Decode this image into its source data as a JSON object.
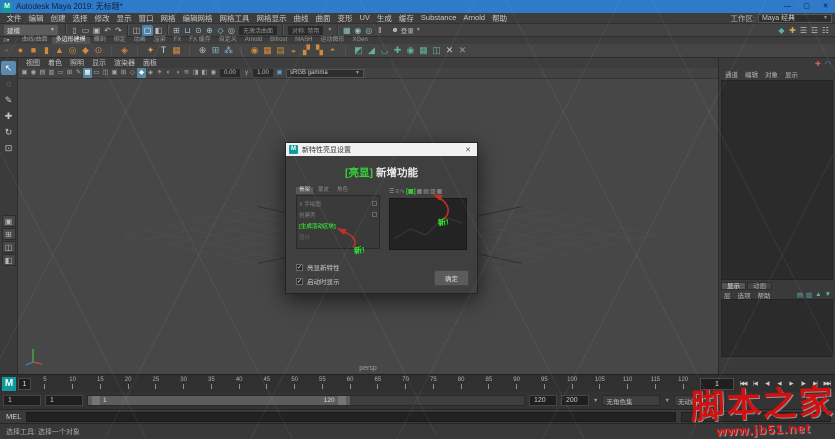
{
  "icons": {
    "chevron_down": "▼",
    "close": "✕",
    "check": "✓",
    "maya_logo": "M"
  },
  "window": {
    "title": "Autodesk Maya 2019: 无标题*",
    "controls": [
      {
        "name": "minimize-button",
        "glyph": "—"
      },
      {
        "name": "maximize-button",
        "glyph": "▢"
      },
      {
        "name": "close-button",
        "glyph": "✕"
      }
    ]
  },
  "menubar": {
    "items": [
      "文件",
      "编辑",
      "创建",
      "选择",
      "修改",
      "显示",
      "窗口",
      "网格",
      "编辑网格",
      "网格工具",
      "网格显示",
      "曲线",
      "曲面",
      "变形",
      "UV",
      "生成",
      "缓存",
      "Substance",
      "Arnold",
      "帮助"
    ],
    "workspace_label": "工作区:",
    "workspace_value": "Maya 经典"
  },
  "statusline": {
    "mode_value": "建模",
    "file_icons": [
      {
        "name": "new-scene-icon",
        "glyph": "▯"
      },
      {
        "name": "open-scene-icon",
        "glyph": "▭"
      },
      {
        "name": "save-scene-icon",
        "glyph": "▣"
      },
      {
        "name": "undo-icon",
        "glyph": "↶"
      },
      {
        "name": "redo-icon",
        "glyph": "↷"
      }
    ],
    "selection_icons": [
      {
        "name": "select-hierarchy-icon",
        "glyph": "◫"
      },
      {
        "name": "select-object-icon",
        "glyph": "▢",
        "active": true
      },
      {
        "name": "select-component-icon",
        "glyph": "◧"
      }
    ],
    "snap_icons": [
      {
        "name": "snap-to-grid-icon",
        "glyph": "⊞",
        "color": "#9cc4d6"
      },
      {
        "name": "snap-to-curve-icon",
        "glyph": "⊔",
        "color": "#9cc4d6"
      },
      {
        "name": "snap-to-point-icon",
        "glyph": "⊙",
        "color": "#9cc4d6"
      },
      {
        "name": "snap-to-projected-center-icon",
        "glyph": "⊕",
        "color": "#9cc4d6"
      },
      {
        "name": "snap-to-view-plane-icon",
        "glyph": "◇",
        "color": "#9cc4d6"
      },
      {
        "name": "make-live-icon",
        "glyph": "◎",
        "color": "#9cc4d6"
      }
    ],
    "surface_field": "无激活曲面",
    "symmetry_field": "对称: 禁用",
    "render_icons": [
      {
        "name": "render-view-icon",
        "glyph": "▦",
        "color": "#8fc3c3"
      },
      {
        "name": "render-current-frame-icon",
        "glyph": "◉",
        "color": "#8fc3c3"
      },
      {
        "name": "ipr-render-icon",
        "glyph": "◎",
        "color": "#8fc3c3"
      },
      {
        "name": "pause-icon",
        "glyph": "‖",
        "color": "#c0c0c0"
      }
    ],
    "signin_label": "登录",
    "person_glyph": "☻",
    "right_icons": [
      {
        "name": "modeling-toolkit-icon",
        "glyph": "◆",
        "color": "#58b0a8"
      },
      {
        "name": "humanik-icon",
        "glyph": "✚",
        "color": "#c7b35a"
      },
      {
        "name": "attribute-editor-icon",
        "glyph": "☰"
      },
      {
        "name": "tool-settings-icon",
        "glyph": "☲"
      },
      {
        "name": "channel-box-icon",
        "glyph": "☷"
      }
    ]
  },
  "shelf": {
    "edge_icons": [
      {
        "name": "shelf-menu-icon",
        "glyph": "≡"
      },
      {
        "name": "shelf-switch-icon",
        "glyph": "▾"
      }
    ],
    "tabs": [
      {
        "label": "曲线/曲面"
      },
      {
        "label": "多边形建模",
        "active": true
      },
      {
        "label": "雕刻"
      },
      {
        "label": "绑定"
      },
      {
        "label": "动画"
      },
      {
        "label": "渲染"
      },
      {
        "label": "FX"
      },
      {
        "label": "FX 缓存"
      },
      {
        "label": "自定义"
      },
      {
        "label": "Arnold"
      },
      {
        "label": "Bifrost"
      },
      {
        "label": "MASH"
      },
      {
        "label": "运动图形"
      },
      {
        "label": "XGen"
      }
    ],
    "icons": [
      {
        "name": "poly-sphere-icon",
        "glyph": "●",
        "color": "#cf8a3c"
      },
      {
        "name": "poly-cube-icon",
        "glyph": "■",
        "color": "#cf8a3c"
      },
      {
        "name": "poly-cylinder-icon",
        "glyph": "▮",
        "color": "#cf8a3c"
      },
      {
        "name": "poly-cone-icon",
        "glyph": "▲",
        "color": "#cf8a3c"
      },
      {
        "name": "poly-torus-icon",
        "glyph": "◎",
        "color": "#cf8a3c"
      },
      {
        "name": "poly-plane-icon",
        "glyph": "◆",
        "color": "#cf8a3c"
      },
      {
        "name": "poly-disc-icon",
        "glyph": "⊙",
        "color": "#cf8a3c"
      },
      {
        "name": "shelf-separator",
        "glyph": "❘",
        "color": "#5a5a5a"
      },
      {
        "name": "platonic-solid-icon",
        "glyph": "◈",
        "color": "#cf8a3c"
      },
      {
        "name": "shelf-separator",
        "glyph": "❘",
        "color": "#5a5a5a"
      },
      {
        "name": "super-shape-icon",
        "glyph": "✦",
        "color": "#d8a050"
      },
      {
        "name": "type-tool-icon",
        "glyph": "T",
        "color": "#d0d0d0"
      },
      {
        "name": "svg-tool-icon",
        "glyph": "▦",
        "color": "#cf8a3c"
      },
      {
        "name": "shelf-separator",
        "glyph": "❘",
        "color": "#5a5a5a"
      },
      {
        "name": "construction-aim-icon",
        "glyph": "⊕",
        "color": "#b8b8b8"
      },
      {
        "name": "measure-tool-icon",
        "glyph": "⊞",
        "color": "#7fb6c6"
      },
      {
        "name": "joint-tool-icon",
        "glyph": "⁂",
        "color": "#7fb6c6"
      },
      {
        "name": "shelf-separator",
        "glyph": "❘",
        "color": "#5a5a5a"
      },
      {
        "name": "sculpt-tool-icon",
        "glyph": "◉",
        "color": "#cf8a3c"
      },
      {
        "name": "mash-network-icon",
        "glyph": "▦",
        "color": "#cf8a3c"
      },
      {
        "name": "lattice-icon",
        "glyph": "▤",
        "color": "#cf8a3c"
      },
      {
        "name": "cluster-icon",
        "glyph": "◒",
        "color": "#cf8a3c"
      },
      {
        "name": "combine-icon",
        "glyph": "▞",
        "color": "#cf8a3c"
      },
      {
        "name": "separate-icon",
        "glyph": "▚",
        "color": "#cf8a3c"
      },
      {
        "name": "smooth-icon",
        "glyph": "◓",
        "color": "#cf8a3c"
      },
      {
        "name": "shelf-separator",
        "glyph": "❘",
        "color": "#5a5a5a"
      },
      {
        "name": "extrude-icon",
        "glyph": "◩",
        "color": "#63b0a2"
      },
      {
        "name": "bevel-icon",
        "glyph": "◢",
        "color": "#63b0a2"
      },
      {
        "name": "bridge-icon",
        "glyph": "◡",
        "color": "#63b0a2"
      },
      {
        "name": "multi-cut-icon",
        "glyph": "✚",
        "color": "#63b0a2"
      },
      {
        "name": "target-weld-icon",
        "glyph": "◉",
        "color": "#63b0a2"
      },
      {
        "name": "quad-draw-icon",
        "glyph": "▦",
        "color": "#63b0a2"
      },
      {
        "name": "symmetrize-icon",
        "glyph": "◫",
        "color": "#63b0a2"
      },
      {
        "name": "delete-edge-icon",
        "glyph": "✕",
        "color": "#c8c8c8"
      },
      {
        "name": "collapse-edge-icon",
        "glyph": "✕",
        "color": "#9a9a9a"
      }
    ]
  },
  "toolbox": {
    "tools": [
      {
        "name": "select-tool",
        "glyph": "↖",
        "active": true
      },
      {
        "name": "lasso-select-tool",
        "glyph": "◌"
      },
      {
        "name": "paint-select-tool",
        "glyph": "✎"
      },
      {
        "name": "move-tool",
        "glyph": "✚"
      },
      {
        "name": "rotate-tool",
        "glyph": "↻"
      },
      {
        "name": "scale-tool",
        "glyph": "⊡"
      }
    ],
    "layouts": [
      {
        "name": "layout-single-pane",
        "glyph": "▣"
      },
      {
        "name": "layout-four-pane",
        "glyph": "⊞"
      },
      {
        "name": "layout-persp-outliner",
        "glyph": "◫"
      },
      {
        "name": "layout-hypershade",
        "glyph": "◧"
      }
    ]
  },
  "viewport": {
    "menus": [
      "视图",
      "着色",
      "照明",
      "显示",
      "渲染器",
      "面板"
    ],
    "iconbar": [
      {
        "name": "select-camera-icon",
        "glyph": "▣"
      },
      {
        "name": "lock-camera-icon",
        "glyph": "◉"
      },
      {
        "name": "camera-attributes-icon",
        "glyph": "▤"
      },
      {
        "name": "bookmarks-icon",
        "glyph": "▥"
      },
      {
        "name": "image-plane-icon",
        "glyph": "▭"
      },
      {
        "name": "2d-pan-zoom-icon",
        "glyph": "⊞"
      },
      {
        "name": "grease-pencil-icon",
        "glyph": "✎"
      },
      {
        "name": "grid-toggle-icon",
        "glyph": "▦",
        "active": true
      },
      {
        "name": "film-gate-icon",
        "glyph": "▭"
      },
      {
        "name": "resolution-gate-icon",
        "glyph": "◫"
      },
      {
        "name": "gate-mask-icon",
        "glyph": "▣"
      },
      {
        "name": "field-chart-icon",
        "glyph": "⊞"
      },
      {
        "name": "wireframe-icon",
        "glyph": "◇"
      },
      {
        "name": "shaded-icon",
        "glyph": "◆",
        "active": true
      },
      {
        "name": "textured-icon",
        "glyph": "◈"
      },
      {
        "name": "use-all-lights-icon",
        "glyph": "☀"
      },
      {
        "name": "shadows-icon",
        "glyph": "◐"
      },
      {
        "name": "ao-icon",
        "glyph": "◑"
      },
      {
        "name": "motion-blur-icon",
        "glyph": "≋"
      },
      {
        "name": "isolate-select-icon",
        "glyph": "◨"
      },
      {
        "name": "xray-icon",
        "glyph": "◧"
      },
      {
        "name": "exposure-icon",
        "glyph": "◉"
      }
    ],
    "exposure_value": "0.00",
    "gamma_icon": "γ",
    "gamma_value": "1.00",
    "view_transform": "sRGB gamma",
    "camera_label": "persp"
  },
  "channel_box": {
    "top_icons": [
      {
        "name": "character-set-icon",
        "glyph": "✚",
        "color": "#cc6655"
      },
      {
        "name": "anim-layer-icon",
        "glyph": "◠",
        "color": "#55aacc"
      }
    ],
    "menus": [
      "通道",
      "编辑",
      "对象",
      "显示"
    ]
  },
  "layer_editor": {
    "tabs": [
      {
        "label": "显示",
        "active": true
      },
      {
        "label": "动画"
      }
    ],
    "menus": [
      "层",
      "选项",
      "帮助"
    ],
    "icons": [
      {
        "name": "new-empty-layer-icon",
        "glyph": "▤"
      },
      {
        "name": "new-layer-from-selected-icon",
        "glyph": "▥"
      },
      {
        "name": "move-layer-up-icon",
        "glyph": "▲"
      },
      {
        "name": "move-layer-down-icon",
        "glyph": "▼"
      }
    ]
  },
  "timeline": {
    "current_frame": "1",
    "ticks": [
      "5",
      "10",
      "15",
      "20",
      "25",
      "30",
      "35",
      "40",
      "45",
      "50",
      "55",
      "60",
      "65",
      "70",
      "75",
      "80",
      "85",
      "90",
      "95",
      "100",
      "105",
      "110",
      "115",
      "120"
    ],
    "frame_field": "1",
    "playback": [
      {
        "name": "go-to-start-button",
        "glyph": "|◀◀"
      },
      {
        "name": "step-back-frame-button",
        "glyph": "|◀"
      },
      {
        "name": "step-back-key-button",
        "glyph": "◀|"
      },
      {
        "name": "play-backwards-button",
        "glyph": "◀"
      },
      {
        "name": "play-forwards-button",
        "glyph": "▶"
      },
      {
        "name": "step-forward-key-button",
        "glyph": "|▶"
      },
      {
        "name": "step-forward-frame-button",
        "glyph": "▶|"
      },
      {
        "name": "go-to-end-button",
        "glyph": "▶▶|"
      }
    ]
  },
  "range": {
    "start_field": "1",
    "current_start_field": "1",
    "range_start_label": "1",
    "range_end_label": "120",
    "end_field": "120",
    "max_field": "200",
    "character_set": "无角色集",
    "anim_layer": "无动画层"
  },
  "command_line": {
    "label": "MEL"
  },
  "help_line": {
    "text": "选择工具: 选择一个对象"
  },
  "dialog": {
    "title": "新特性亮显设置",
    "heading_highlight": "[亮显]",
    "heading_text": "新增功能",
    "new_badge": "新!",
    "left_preview": {
      "tabs": [
        {
          "label": "骨架",
          "active": true
        },
        {
          "label": "蒙皮"
        },
        {
          "label": "角色"
        }
      ],
      "items": {
        "i0": "X 手绘图",
        "i1": "创建壳",
        "i2": "[生成活动区块]",
        "i3": "圆台"
      }
    },
    "right_preview": {
      "icons": [
        {
          "name": "preview-menu-icon",
          "glyph": "☰"
        },
        {
          "name": "preview-list-icon",
          "glyph": "≡"
        },
        {
          "name": "preview-curve-icon",
          "glyph": "∿"
        },
        {
          "name": "preview-new-shelf-icon",
          "glyph": "[▦]",
          "active": true
        },
        {
          "name": "preview-shelf-icon",
          "glyph": "▦"
        },
        {
          "name": "preview-shelf-icon",
          "glyph": "▤"
        },
        {
          "name": "preview-shelf-icon",
          "glyph": "▥"
        },
        {
          "name": "preview-shelf-icon",
          "glyph": "▦"
        }
      ]
    },
    "checkbox1_label": "亮显新特性",
    "checkbox2_label": "启动时显示",
    "ok_label": "确定"
  },
  "watermark": {
    "line1": "脚本之家",
    "line2": "www.jb51.net"
  }
}
